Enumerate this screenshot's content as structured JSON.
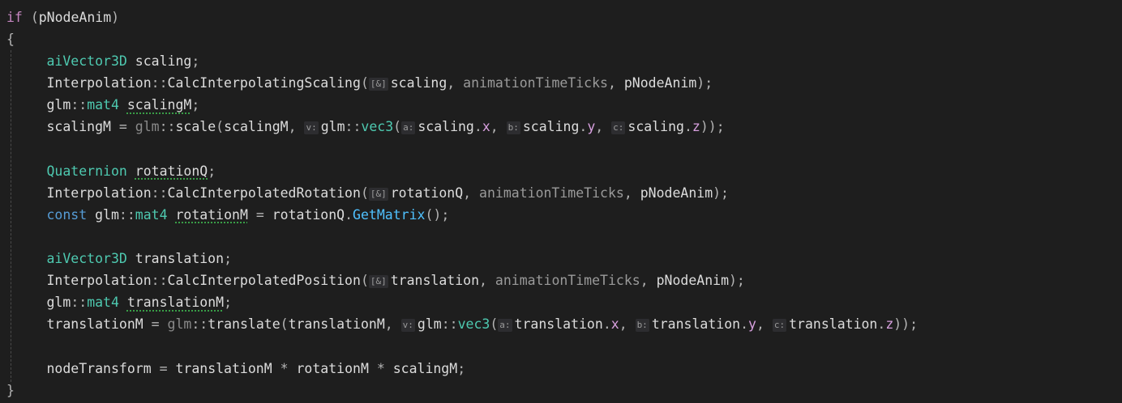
{
  "code": {
    "l1": {
      "kw_if": "if",
      "sp": " ",
      "lp": "(",
      "cond": "pNodeAnim",
      "rp": ")"
    },
    "l2": {
      "brace": "{"
    },
    "l3": {
      "type": "aiVector3D",
      "sp": " ",
      "var": "scaling",
      "semi": ";"
    },
    "l4": {
      "cls": "Interpolation",
      "scope": "::",
      "fn": "CalcInterpolatingScaling",
      "lp": "(",
      "hint": "[&]",
      "arg1": "scaling",
      "c1": ", ",
      "arg2": "animationTimeTicks",
      "c2": ", ",
      "arg3": "pNodeAnim",
      "rp": ");"
    },
    "l5": {
      "ns": "glm",
      "scope": "::",
      "type": "mat4",
      "sp": " ",
      "var": "scalingM",
      "semi": ";"
    },
    "l6": {
      "lhs": "scalingM",
      "eq": " = ",
      "ns": "glm",
      "scope": "::",
      "fn": "scale",
      "lp": "(",
      "a1": "scalingM",
      "c1": ", ",
      "hint_v": "v:",
      "ns2": "glm",
      "scope2": "::",
      "type": "vec3",
      "lp2": "(",
      "hint_a": "a:",
      "ax": "scaling",
      "dotx": ".",
      "x": "x",
      "c2": ", ",
      "hint_b": "b:",
      "ay": "scaling",
      "doty": ".",
      "y": "y",
      "c3": ", ",
      "hint_c": "c:",
      "az": "scaling",
      "dotz": ".",
      "z": "z",
      "rp": "));"
    },
    "l8": {
      "type": "Quaternion",
      "sp": " ",
      "var": "rotationQ",
      "semi": ";"
    },
    "l9": {
      "cls": "Interpolation",
      "scope": "::",
      "fn": "CalcInterpolatedRotation",
      "lp": "(",
      "hint": "[&]",
      "arg1": "rotationQ",
      "c1": ", ",
      "arg2": "animationTimeTicks",
      "c2": ", ",
      "arg3": "pNodeAnim",
      "rp": ");"
    },
    "l10": {
      "kw": "const",
      "sp": " ",
      "ns": "glm",
      "scope": "::",
      "type": "mat4",
      "sp2": " ",
      "var": "rotationM",
      "eq": " = ",
      "obj": "rotationQ",
      "dot": ".",
      "method": "GetMatrix",
      "call": "();"
    },
    "l12": {
      "type": "aiVector3D",
      "sp": " ",
      "var": "translation",
      "semi": ";"
    },
    "l13": {
      "cls": "Interpolation",
      "scope": "::",
      "fn": "CalcInterpolatedPosition",
      "lp": "(",
      "hint": "[&]",
      "arg1": "translation",
      "c1": ", ",
      "arg2": "animationTimeTicks",
      "c2": ", ",
      "arg3": "pNodeAnim",
      "rp": ");"
    },
    "l14": {
      "ns": "glm",
      "scope": "::",
      "type": "mat4",
      "sp": " ",
      "var": "translationM",
      "semi": ";"
    },
    "l15": {
      "lhs": "translationM",
      "eq": " = ",
      "ns": "glm",
      "scope": "::",
      "fn": "translate",
      "lp": "(",
      "a1": "translationM",
      "c1": ", ",
      "hint_v": "v:",
      "ns2": "glm",
      "scope2": "::",
      "type": "vec3",
      "lp2": "(",
      "hint_a": "a:",
      "ax": "translation",
      "dotx": ".",
      "x": "x",
      "c2": ", ",
      "hint_b": "b:",
      "ay": "translation",
      "doty": ".",
      "y": "y",
      "c3": ", ",
      "hint_c": "c:",
      "az": "translation",
      "dotz": ".",
      "z": "z",
      "rp": "));"
    },
    "l17": {
      "lhs": "nodeTransform",
      "eq": " = ",
      "t": "translationM",
      "m1": " * ",
      "r": "rotationM",
      "m2": " * ",
      "s": "scalingM",
      "semi": ";"
    },
    "l18": {
      "brace": "}"
    }
  }
}
